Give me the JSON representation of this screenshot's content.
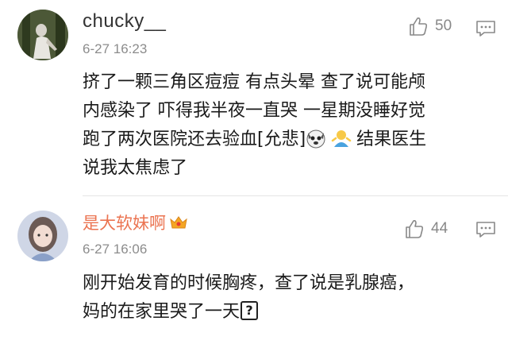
{
  "comments": [
    {
      "username": "chucky__",
      "timestamp": "6-27 16:23",
      "likes": "50",
      "lines": [
        "挤了一颗三角区痘痘 有点头晕 查了说可能颅",
        "内感染了 吓得我半夜一直哭 一星期没睡好觉",
        "跑了两次医院还去验血[允悲]",
        "说我太焦虑了"
      ],
      "line3_tail": "结果医生",
      "icons": [
        "avatar",
        "like-icon",
        "reply-icon",
        "dog-emoji",
        "shrug-emoji"
      ]
    },
    {
      "username": "是大软妹啊",
      "timestamp": "6-27 16:06",
      "likes": "44",
      "lines": [
        "刚开始发育的时候胸疼，查了说是乳腺癌，",
        "妈的在家里哭了一天"
      ],
      "q_mark": "?",
      "icons": [
        "avatar",
        "vip-crown-icon",
        "like-icon",
        "reply-icon",
        "question-box-icon"
      ]
    }
  ],
  "colors": {
    "username_default": "#333333",
    "username_vip": "#eb7350",
    "timestamp": "#8c8c8c",
    "icon_gray": "#888888",
    "divider": "#e5e5e5"
  }
}
